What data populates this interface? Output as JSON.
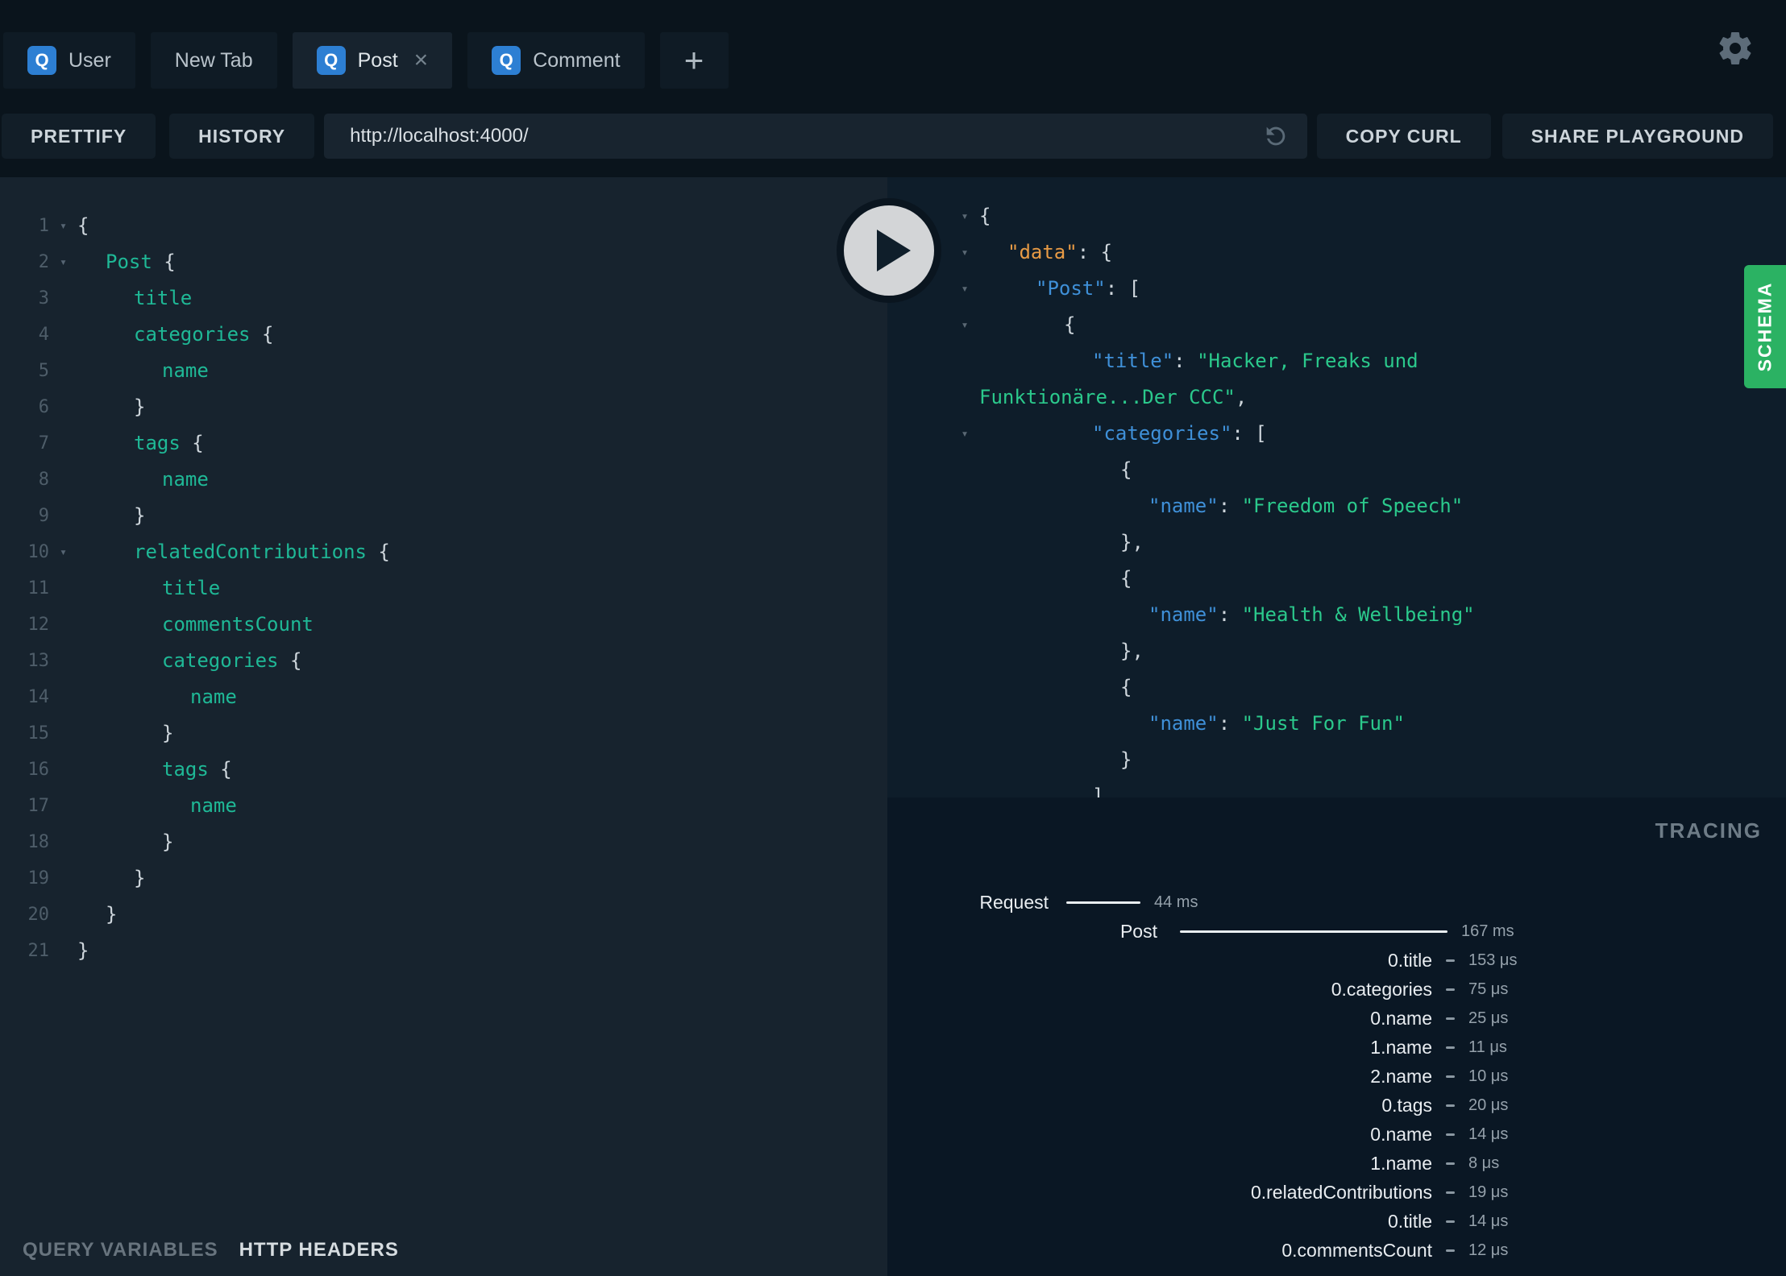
{
  "colors": {
    "q_badge_blue": "#2d7fd3",
    "schema_green": "#2bb263",
    "field_green": "#1fb896",
    "string_green": "#2bc98c",
    "key_blue": "#3f90d8",
    "key_orange": "#e89b45"
  },
  "tabs": {
    "q_badge": "Q",
    "close_glyph": "×",
    "add_tab": "+",
    "items": [
      {
        "label": "User",
        "has_q_icon": true,
        "active": false,
        "closable": false
      },
      {
        "label": "New Tab",
        "has_q_icon": false,
        "active": false,
        "closable": false
      },
      {
        "label": "Post",
        "has_q_icon": true,
        "active": true,
        "closable": true
      },
      {
        "label": "Comment",
        "has_q_icon": true,
        "active": false,
        "closable": false
      }
    ]
  },
  "toolbar": {
    "prettify": "PRETTIFY",
    "history": "HISTORY",
    "url": "http://localhost:4000/",
    "copy_curl": "COPY CURL",
    "share_playground": "SHARE PLAYGROUND"
  },
  "query_editor": {
    "fold_glyph": "▾",
    "lines": [
      {
        "num": 1,
        "fold": true,
        "indent": 0,
        "tokens": [
          {
            "t": "p",
            "v": "{"
          }
        ]
      },
      {
        "num": 2,
        "fold": true,
        "indent": 1,
        "tokens": [
          {
            "t": "f",
            "v": "Post"
          },
          {
            "t": "p",
            "v": " {"
          }
        ]
      },
      {
        "num": 3,
        "fold": false,
        "indent": 2,
        "tokens": [
          {
            "t": "f",
            "v": "title"
          }
        ]
      },
      {
        "num": 4,
        "fold": false,
        "indent": 2,
        "tokens": [
          {
            "t": "f",
            "v": "categories"
          },
          {
            "t": "p",
            "v": " {"
          }
        ]
      },
      {
        "num": 5,
        "fold": false,
        "indent": 3,
        "tokens": [
          {
            "t": "f",
            "v": "name"
          }
        ]
      },
      {
        "num": 6,
        "fold": false,
        "indent": 2,
        "tokens": [
          {
            "t": "p",
            "v": "}"
          }
        ]
      },
      {
        "num": 7,
        "fold": false,
        "indent": 2,
        "tokens": [
          {
            "t": "f",
            "v": "tags"
          },
          {
            "t": "p",
            "v": " {"
          }
        ]
      },
      {
        "num": 8,
        "fold": false,
        "indent": 3,
        "tokens": [
          {
            "t": "f",
            "v": "name"
          }
        ]
      },
      {
        "num": 9,
        "fold": false,
        "indent": 2,
        "tokens": [
          {
            "t": "p",
            "v": "}"
          }
        ]
      },
      {
        "num": 10,
        "fold": true,
        "indent": 2,
        "tokens": [
          {
            "t": "f",
            "v": "relatedContributions"
          },
          {
            "t": "p",
            "v": " {"
          }
        ]
      },
      {
        "num": 11,
        "fold": false,
        "indent": 3,
        "tokens": [
          {
            "t": "f",
            "v": "title"
          }
        ]
      },
      {
        "num": 12,
        "fold": false,
        "indent": 3,
        "tokens": [
          {
            "t": "f",
            "v": "commentsCount"
          }
        ]
      },
      {
        "num": 13,
        "fold": false,
        "indent": 3,
        "tokens": [
          {
            "t": "f",
            "v": "categories"
          },
          {
            "t": "p",
            "v": " {"
          }
        ]
      },
      {
        "num": 14,
        "fold": false,
        "indent": 4,
        "tokens": [
          {
            "t": "f",
            "v": "name"
          }
        ]
      },
      {
        "num": 15,
        "fold": false,
        "indent": 3,
        "tokens": [
          {
            "t": "p",
            "v": "}"
          }
        ]
      },
      {
        "num": 16,
        "fold": false,
        "indent": 3,
        "tokens": [
          {
            "t": "f",
            "v": "tags"
          },
          {
            "t": "p",
            "v": " {"
          }
        ]
      },
      {
        "num": 17,
        "fold": false,
        "indent": 4,
        "tokens": [
          {
            "t": "f",
            "v": "name"
          }
        ]
      },
      {
        "num": 18,
        "fold": false,
        "indent": 3,
        "tokens": [
          {
            "t": "p",
            "v": "}"
          }
        ]
      },
      {
        "num": 19,
        "fold": false,
        "indent": 2,
        "tokens": [
          {
            "t": "p",
            "v": "}"
          }
        ]
      },
      {
        "num": 20,
        "fold": false,
        "indent": 1,
        "tokens": [
          {
            "t": "p",
            "v": "}"
          }
        ]
      },
      {
        "num": 21,
        "fold": false,
        "indent": 0,
        "tokens": [
          {
            "t": "p",
            "v": "}"
          }
        ]
      }
    ]
  },
  "response": {
    "fold_glyph": "▾",
    "lines": [
      {
        "arrow": true,
        "indent": 0,
        "tokens": [
          {
            "t": "p",
            "v": "{"
          }
        ]
      },
      {
        "arrow": true,
        "indent": 1,
        "tokens": [
          {
            "t": "o",
            "v": "\"data\""
          },
          {
            "t": "p",
            "v": ": {"
          }
        ]
      },
      {
        "arrow": true,
        "indent": 2,
        "tokens": [
          {
            "t": "k",
            "v": "\"Post\""
          },
          {
            "t": "p",
            "v": ": ["
          }
        ]
      },
      {
        "arrow": true,
        "indent": 3,
        "tokens": [
          {
            "t": "p",
            "v": "{"
          }
        ]
      },
      {
        "arrow": false,
        "indent": 4,
        "tokens": [
          {
            "t": "k",
            "v": "\"title\""
          },
          {
            "t": "p",
            "v": ": "
          },
          {
            "t": "s",
            "v": "\"Hacker, Freaks und"
          }
        ]
      },
      {
        "arrow": false,
        "indent": 0,
        "tokens": [
          {
            "t": "s",
            "v": "Funktionäre...Der CCC\""
          },
          {
            "t": "p",
            "v": ","
          }
        ]
      },
      {
        "arrow": true,
        "indent": 4,
        "tokens": [
          {
            "t": "k",
            "v": "\"categories\""
          },
          {
            "t": "p",
            "v": ": ["
          }
        ]
      },
      {
        "arrow": false,
        "indent": 5,
        "tokens": [
          {
            "t": "p",
            "v": "{"
          }
        ]
      },
      {
        "arrow": false,
        "indent": 6,
        "tokens": [
          {
            "t": "k",
            "v": "\"name\""
          },
          {
            "t": "p",
            "v": ": "
          },
          {
            "t": "s",
            "v": "\"Freedom of Speech\""
          }
        ]
      },
      {
        "arrow": false,
        "indent": 5,
        "tokens": [
          {
            "t": "p",
            "v": "},"
          }
        ]
      },
      {
        "arrow": false,
        "indent": 5,
        "tokens": [
          {
            "t": "p",
            "v": "{"
          }
        ]
      },
      {
        "arrow": false,
        "indent": 6,
        "tokens": [
          {
            "t": "k",
            "v": "\"name\""
          },
          {
            "t": "p",
            "v": ": "
          },
          {
            "t": "s",
            "v": "\"Health & Wellbeing\""
          }
        ]
      },
      {
        "arrow": false,
        "indent": 5,
        "tokens": [
          {
            "t": "p",
            "v": "},"
          }
        ]
      },
      {
        "arrow": false,
        "indent": 5,
        "tokens": [
          {
            "t": "p",
            "v": "{"
          }
        ]
      },
      {
        "arrow": false,
        "indent": 6,
        "tokens": [
          {
            "t": "k",
            "v": "\"name\""
          },
          {
            "t": "p",
            "v": ": "
          },
          {
            "t": "s",
            "v": "\"Just For Fun\""
          }
        ]
      },
      {
        "arrow": false,
        "indent": 5,
        "tokens": [
          {
            "t": "p",
            "v": "}"
          }
        ]
      },
      {
        "arrow": false,
        "indent": 4,
        "tokens": [
          {
            "t": "p",
            "v": "]"
          }
        ]
      }
    ]
  },
  "schema_label": "SCHEMA",
  "tracing": {
    "title": "TRACING",
    "rows": [
      {
        "label": "Request",
        "time": "44 ms",
        "kind": "request"
      },
      {
        "label": "Post",
        "time": "167 ms",
        "kind": "post"
      },
      {
        "label": "0.title",
        "time": "153 μs",
        "kind": "field"
      },
      {
        "label": "0.categories",
        "time": "75 μs",
        "kind": "field"
      },
      {
        "label": "0.name",
        "time": "25 μs",
        "kind": "field"
      },
      {
        "label": "1.name",
        "time": "11 μs",
        "kind": "field"
      },
      {
        "label": "2.name",
        "time": "10 μs",
        "kind": "field"
      },
      {
        "label": "0.tags",
        "time": "20 μs",
        "kind": "field"
      },
      {
        "label": "0.name",
        "time": "14 μs",
        "kind": "field"
      },
      {
        "label": "1.name",
        "time": "8 μs",
        "kind": "field"
      },
      {
        "label": "0.relatedContributions",
        "time": "19 μs",
        "kind": "field"
      },
      {
        "label": "0.title",
        "time": "14 μs",
        "kind": "field"
      },
      {
        "label": "0.commentsCount",
        "time": "12 μs",
        "kind": "field"
      }
    ]
  },
  "footer": {
    "query_variables": "QUERY VARIABLES",
    "http_headers": "HTTP HEADERS"
  }
}
